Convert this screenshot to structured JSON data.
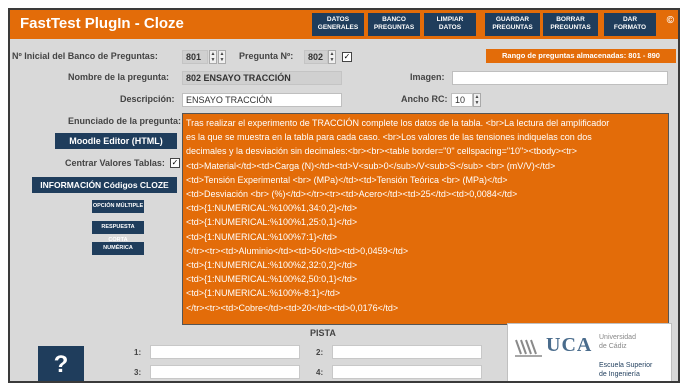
{
  "app_title": "FastTest PlugIn - Cloze",
  "header_buttons": [
    {
      "line1": "DATOS",
      "line2": "GENERALES"
    },
    {
      "line1": "BANCO",
      "line2": "PREGUNTAS"
    },
    {
      "line1": "LIMPIAR",
      "line2": "DATOS"
    },
    {
      "line1": "GUARDAR",
      "line2": "PREGUNTAS"
    },
    {
      "line1": "BORRAR",
      "line2": "PREGUNTAS"
    },
    {
      "line1": "DAR",
      "line2": "FORMATO"
    }
  ],
  "copyright": "©",
  "form": {
    "bank_start_label": "Nº Inicial del Banco de Preguntas:",
    "bank_start_value": "801",
    "question_num_label": "Pregunta Nº:",
    "question_num_value": "802",
    "range_text": "Rango de preguntas almacenadas: 801 - 890",
    "name_label": "Nombre de la pregunta:",
    "name_value": "802 ENSAYO TRACCIÓN",
    "image_label": "Imagen:",
    "image_value": "",
    "description_label": "Descripción:",
    "description_value": "ENSAYO TRACCIÓN",
    "width_label": "Ancho RC:",
    "width_value": "10",
    "statement_label": "Enunciado de la pregunta:",
    "center_label": "Centrar Valores Tablas:"
  },
  "buttons": {
    "moodle_editor": "Moodle Editor (HTML)",
    "cloze_info": "INFORMACIÓN Códigos CLOZE",
    "multiple_choice": "OPCIÓN MÚLTIPLE",
    "short_answer": "RESPUESTA CORTA",
    "numeric": "NUMÉRICA"
  },
  "editor_lines": [
    "Tras realizar el experimento de TRACCIÓN complete los datos de la tabla. <br>La lectura del amplificador",
    "es la que se muestra en la tabla para cada caso. <br>Los valores de las tensiones indiquelas con dos",
    "decimales y la desviación sin decimales:<br><br><table border=\"0\" cellspacing=\"10\"><tbody><tr>",
    "<td>Material</td><td>Carga (N)</td><td>V<sub>0</sub>/V<sub>S</sub> <br> (mV/V)</td>",
    "<td>Tensión Experimental <br> (MPa)</td><td>Tensión Teórica <br> (MPa)</td>",
    "<td>Desviación <br> (%)</td></tr><tr><td>Acero</td><td>25</td><td>0,0084</td>",
    "<td>{1:NUMERICAL:%100%1,34:0,2}</td>",
    "<td>{1:NUMERICAL:%100%1,25:0,1}</td>",
    "<td>{1:NUMERICAL:%100%7:1}</td>",
    "</tr><tr><td>Aluminio</td><td>50</td><td>0,0459</td>",
    "<td>{1:NUMERICAL:%100%2,32:0,2}</td>",
    "<td>{1:NUMERICAL:%100%2,50:0,1}</td>",
    "<td>{1:NUMERICAL:%100%-8:1}</td>",
    "</tr><tr><td>Cobre</td><td>20</td><td>0,0176</td>"
  ],
  "pista": {
    "title": "PISTA",
    "labels": [
      "1:",
      "2:",
      "3:",
      "4:"
    ],
    "help": "?"
  },
  "logo": {
    "acronym": "UCA",
    "university_line1": "Universidad",
    "university_line2": "de Cádiz",
    "school_line1": "Escuela Superior",
    "school_line2": "de Ingeniería"
  }
}
